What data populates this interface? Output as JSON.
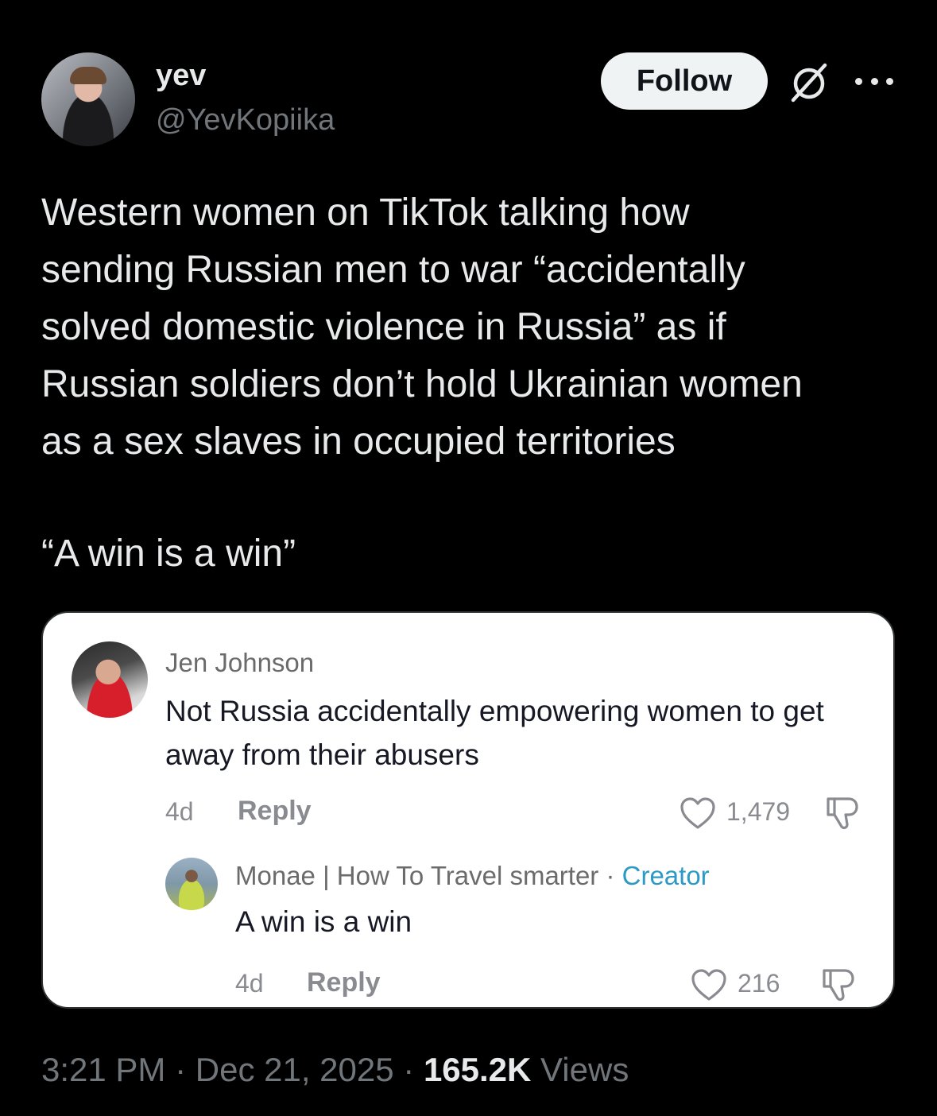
{
  "author": {
    "display_name": "yev",
    "handle": "@YevKopiika"
  },
  "follow_label": "Follow",
  "tweet": {
    "text": "Western women on TikTok talking how\nsending Russian men to war “accidentally\nsolved domestic violence in Russia” as if\nRussian soldiers don’t hold Ukrainian women\nas a sex slaves in occupied territories",
    "quote": "“A win is a win”"
  },
  "embedded_screenshot": {
    "comment": {
      "author": "Jen Johnson",
      "text": "Not Russia accidentally empowering women to get away from their abusers",
      "age": "4d",
      "reply_label": "Reply",
      "likes": "1,479"
    },
    "reply": {
      "author": "Monae | How To Travel smarter",
      "separator": " · ",
      "badge": "Creator",
      "text": "A win is a win",
      "age": "4d",
      "reply_label": "Reply",
      "likes": "216"
    }
  },
  "meta": {
    "time": "3:21 PM",
    "sep1": " · ",
    "date": "Dec 21, 2025",
    "sep2": " · ",
    "views_count": "165.2K",
    "views_label": " Views"
  },
  "icons": [
    "grok-icon",
    "more-icon",
    "heart-icon",
    "dislike-icon"
  ]
}
